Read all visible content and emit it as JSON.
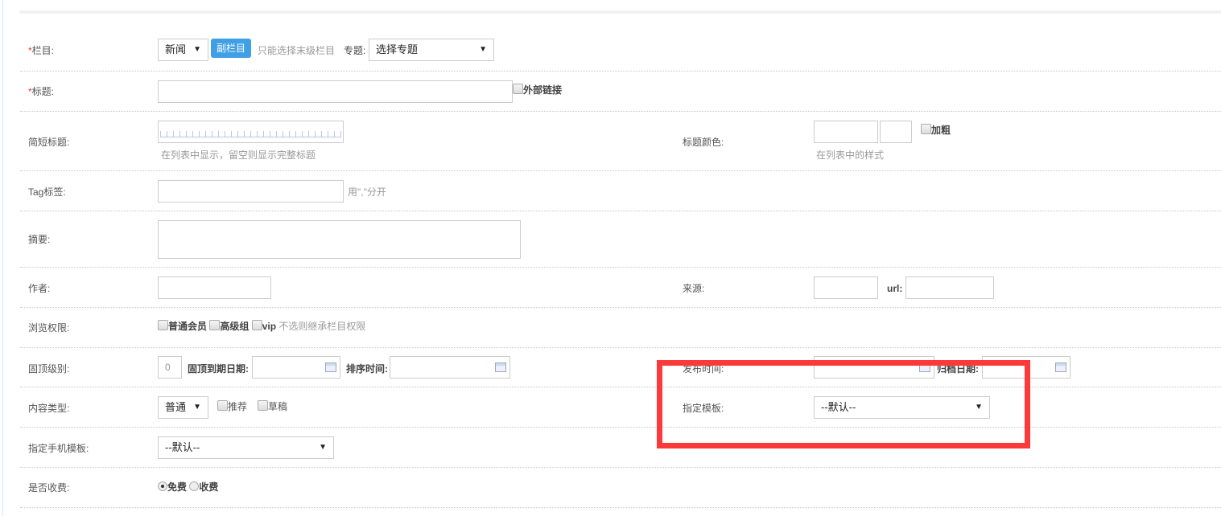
{
  "colors": {
    "accent": "#3fa0e6",
    "required": "#ee3333",
    "highlight_box": "#fc3a3a"
  },
  "rows": {
    "column": {
      "label": "栏目:",
      "value": "新闻",
      "sub_button": "副栏目",
      "hint": "只能选择末级栏目",
      "topic_label": "专题:",
      "topic_value": "选择专题"
    },
    "title": {
      "label": "标题:",
      "external_link": "外部链接"
    },
    "short_title": {
      "label": "简短标题:",
      "hint": "在列表中显示，留空则显示完整标题"
    },
    "title_color": {
      "label": "标题颜色:",
      "bold": "加粗",
      "hint": "在列表中的样式"
    },
    "tags": {
      "label": "Tag标签:",
      "hint": "用\",\"分开"
    },
    "summary": {
      "label": "摘要:"
    },
    "author": {
      "label": "作者:"
    },
    "source": {
      "label": "来源:",
      "url_label": "url:"
    },
    "permission": {
      "label": "浏览权限:",
      "options": [
        "普通会员",
        "高级组",
        "vip"
      ],
      "hint": "不选则继承栏目权限"
    },
    "pin": {
      "label": "固顶级别:",
      "value": "0",
      "expire_label": "固顶到期日期:",
      "sort_label": "排序时间:"
    },
    "publish": {
      "label": "发布时间:",
      "archive_label": "归档日期:"
    },
    "content_type": {
      "label": "内容类型:",
      "value": "普通",
      "recommend": "推荐",
      "draft": "草稿"
    },
    "template": {
      "label": "指定模板:",
      "value": "--默认--"
    },
    "mobile_template": {
      "label": "指定手机模板:",
      "value": "--默认--"
    },
    "charge": {
      "label": "是否收费:",
      "free": "免费",
      "paid": "收费"
    }
  }
}
